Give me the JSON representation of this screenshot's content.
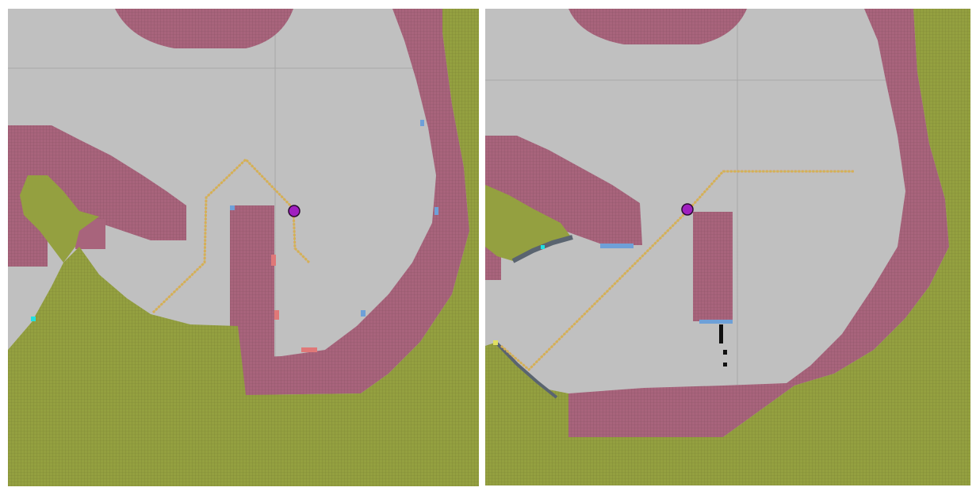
{
  "scene": {
    "type": "occupancy-grid-path-planning",
    "panels": [
      {
        "id": "left",
        "robot_icon": "robot-position-marker"
      },
      {
        "id": "right",
        "robot_icon": "robot-position-marker"
      }
    ],
    "legend_colors": {
      "free": "#c0c0c0",
      "inflated_obstacle": "#a8647c",
      "unknown_terrain": "#94a040",
      "path": "#e0a060",
      "robot": "#a020c0",
      "edge_blue": "#6ea0d8",
      "edge_red": "#e07878",
      "dark_cells": "#5a6470",
      "grid_line": "#a8a8a8"
    }
  }
}
